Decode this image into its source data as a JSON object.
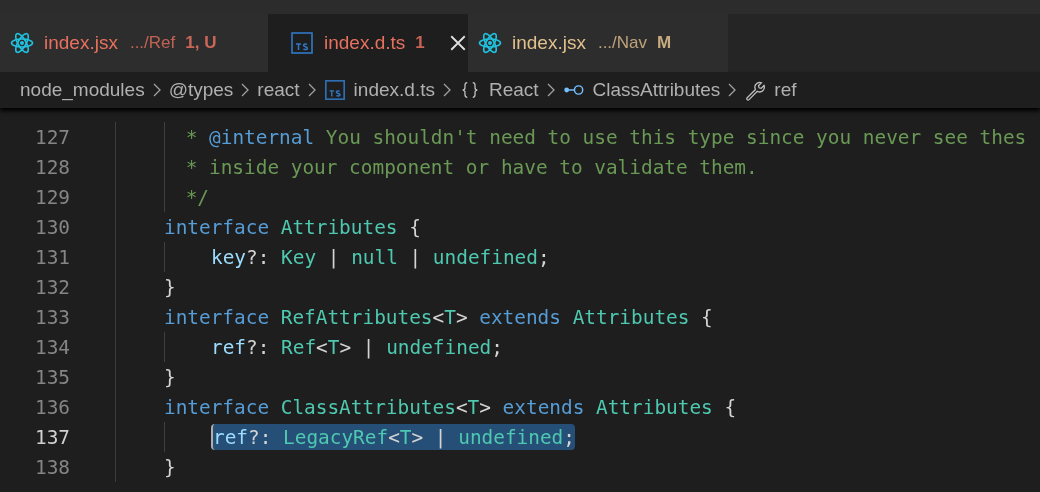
{
  "tabs": [
    {
      "kind": "react",
      "name": "index.jsx",
      "description": ".../Ref",
      "badge": "1, U",
      "color": "#e8705f",
      "selected": false
    },
    {
      "kind": "ts",
      "name": "index.d.ts",
      "badge": "1",
      "color": "#e8705f",
      "selected": true
    },
    {
      "kind": "react",
      "name": "index.jsx",
      "description": ".../Nav",
      "badge": "M",
      "color": "#e2c08d",
      "selected": false
    }
  ],
  "breadcrumbs": [
    {
      "kind": "folder",
      "label": "node_modules"
    },
    {
      "kind": "folder",
      "label": "@types"
    },
    {
      "kind": "folder",
      "label": "react"
    },
    {
      "kind": "ts-file",
      "label": "index.d.ts"
    },
    {
      "kind": "namespace",
      "label": "React"
    },
    {
      "kind": "interface",
      "label": "ClassAttributes"
    },
    {
      "kind": "property",
      "label": "ref"
    }
  ],
  "editor": {
    "lines": [
      {
        "number": "127",
        "selected": false,
        "tokens": [
          {
            "kind": "comment",
            "text": " * "
          },
          {
            "kind": "doc-tag",
            "text": "@internal"
          },
          {
            "kind": "comment",
            "text": " You shouldn't need to use this type since you never see thes"
          }
        ]
      },
      {
        "number": "128",
        "selected": false,
        "tokens": [
          {
            "kind": "comment",
            "text": " * inside your component or have to validate them."
          }
        ]
      },
      {
        "number": "129",
        "selected": false,
        "tokens": [
          {
            "kind": "comment",
            "text": " */"
          }
        ]
      },
      {
        "number": "130",
        "selected": false,
        "tokens": [
          {
            "kind": "keyword",
            "text": "interface "
          },
          {
            "kind": "type",
            "text": "Attributes"
          },
          {
            "kind": "punct",
            "text": " {"
          }
        ],
        "children": [
          {
            "number": "131",
            "selected": false,
            "tokens": [
              {
                "kind": "prop",
                "text": "key"
              },
              {
                "kind": "punct",
                "text": "?: "
              },
              {
                "kind": "type",
                "text": "Key"
              },
              {
                "kind": "punct",
                "text": " | "
              },
              {
                "kind": "type",
                "text": "null"
              },
              {
                "kind": "punct",
                "text": " | "
              },
              {
                "kind": "type",
                "text": "undefined"
              },
              {
                "kind": "punct",
                "text": ";"
              }
            ]
          }
        ]
      },
      {
        "number": "132",
        "selected": false,
        "tokens": [
          {
            "kind": "punct",
            "text": "}"
          }
        ]
      },
      {
        "number": "133",
        "selected": false,
        "tokens": [
          {
            "kind": "keyword",
            "text": "interface "
          },
          {
            "kind": "type",
            "text": "RefAttributes"
          },
          {
            "kind": "punct",
            "text": "<"
          },
          {
            "kind": "type",
            "text": "T"
          },
          {
            "kind": "punct",
            "text": "> "
          },
          {
            "kind": "keyword",
            "text": "extends "
          },
          {
            "kind": "type",
            "text": "Attributes"
          },
          {
            "kind": "punct",
            "text": " {"
          }
        ],
        "children": [
          {
            "number": "134",
            "selected": false,
            "tokens": [
              {
                "kind": "prop",
                "text": "ref"
              },
              {
                "kind": "punct",
                "text": "?: "
              },
              {
                "kind": "type",
                "text": "Ref"
              },
              {
                "kind": "punct",
                "text": "<"
              },
              {
                "kind": "type",
                "text": "T"
              },
              {
                "kind": "punct",
                "text": "> | "
              },
              {
                "kind": "type",
                "text": "undefined"
              },
              {
                "kind": "punct",
                "text": ";"
              }
            ]
          }
        ]
      },
      {
        "number": "135",
        "selected": false,
        "tokens": [
          {
            "kind": "punct",
            "text": "}"
          }
        ]
      },
      {
        "number": "136",
        "selected": false,
        "tokens": [
          {
            "kind": "keyword",
            "text": "interface "
          },
          {
            "kind": "type",
            "text": "ClassAttributes"
          },
          {
            "kind": "punct",
            "text": "<"
          },
          {
            "kind": "type",
            "text": "T"
          },
          {
            "kind": "punct",
            "text": "> "
          },
          {
            "kind": "keyword",
            "text": "extends "
          },
          {
            "kind": "type",
            "text": "Attributes"
          },
          {
            "kind": "punct",
            "text": " {"
          }
        ],
        "children": [
          {
            "number": "137",
            "selected": true,
            "tokens": [
              {
                "kind": "prop",
                "text": "ref"
              },
              {
                "kind": "punct",
                "text": "?: "
              },
              {
                "kind": "type",
                "text": "LegacyRef"
              },
              {
                "kind": "punct",
                "text": "<"
              },
              {
                "kind": "type",
                "text": "T"
              },
              {
                "kind": "punct",
                "text": "> | "
              },
              {
                "kind": "type",
                "text": "undefined"
              },
              {
                "kind": "punct",
                "text": ";"
              }
            ]
          }
        ]
      },
      {
        "number": "138",
        "selected": false,
        "tokens": [
          {
            "kind": "punct",
            "text": "}"
          }
        ]
      }
    ]
  }
}
